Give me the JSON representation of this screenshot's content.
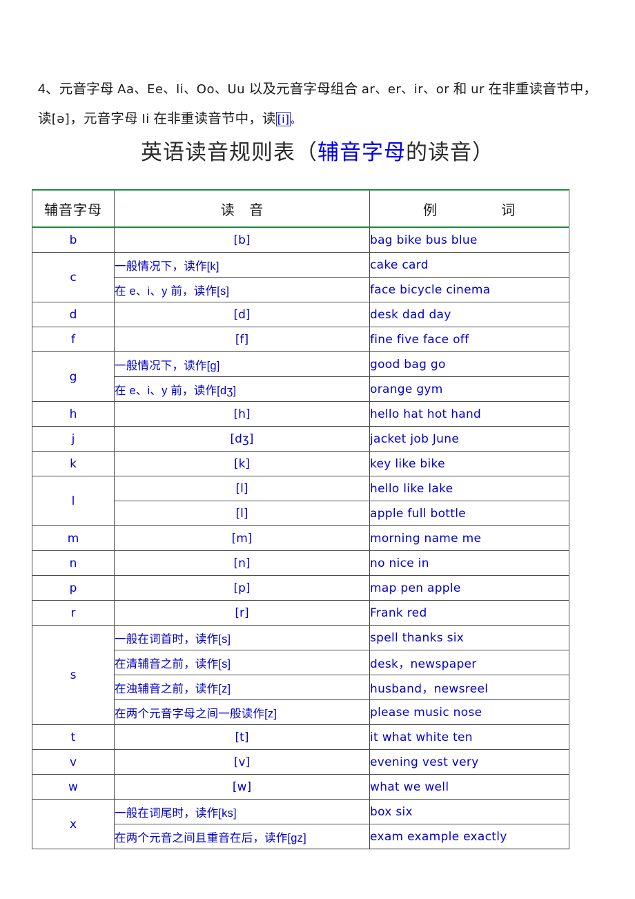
{
  "intro": {
    "line1_a": "4、元音字母 ",
    "line1_latin1": "Aa、Ee、Ii、Oo、Uu",
    "line1_b": " 以及元音字母组合 ",
    "line1_latin2": "ar、er、ir、or",
    "line1_c": " 和 ",
    "line1_latin3": "ur",
    "line1_d": " 在非重读音节中，读",
    "line1_ipa1": "[ə]",
    "line1_e": "，元音字母 ",
    "line1_latin4": "Ii",
    "line1_f": " 在非重读音节中，读",
    "line1_ipa2": "[i]",
    "line1_g": "。"
  },
  "title": {
    "prefix": "英语读音规则表（",
    "highlight": "辅音字母",
    "suffix": "的读音）"
  },
  "table": {
    "headers": {
      "letter": "辅音字母",
      "pronunciation": "读 音",
      "examples_a": "例",
      "examples_b": "词"
    },
    "rows": [
      {
        "letter": "b",
        "subrows": [
          {
            "rule": "",
            "ipa": "[b]",
            "words": "bag  bike  bus  blue"
          }
        ]
      },
      {
        "letter": "c",
        "subrows": [
          {
            "rule": "一般情况下，读作[k]",
            "ipa": "",
            "words": "cake   card"
          },
          {
            "rule": "在 e、i、y 前，读作[s]",
            "ipa": "",
            "words": "face  bicycle  cinema"
          }
        ]
      },
      {
        "letter": "d",
        "subrows": [
          {
            "rule": "",
            "ipa": "[d]",
            "words": "desk  dad  day"
          }
        ]
      },
      {
        "letter": "f",
        "subrows": [
          {
            "rule": "",
            "ipa": "[f]",
            "words": "fine  five  face  off"
          }
        ]
      },
      {
        "letter": "g",
        "subrows": [
          {
            "rule": "一般情况下，读作[g]",
            "ipa": "",
            "words": "good  bag  go"
          },
          {
            "rule": "在 e、i、y 前，读作[dʒ]",
            "ipa": "",
            "words": "orange  gym"
          }
        ]
      },
      {
        "letter": "h",
        "subrows": [
          {
            "rule": "",
            "ipa": "[h]",
            "words": "hello  hat  hot  hand"
          }
        ]
      },
      {
        "letter": "j",
        "subrows": [
          {
            "rule": "",
            "ipa": "[dʒ]",
            "words": "jacket  job  June"
          }
        ]
      },
      {
        "letter": "k",
        "subrows": [
          {
            "rule": "",
            "ipa": "[k]",
            "words": "key  like  bike"
          }
        ]
      },
      {
        "letter": "l",
        "subrows": [
          {
            "rule": "",
            "ipa": "[l]",
            "words": "hello  like  lake"
          },
          {
            "rule": "",
            "ipa": "[l]",
            "words": "apple  full  bottle"
          }
        ]
      },
      {
        "letter": "m",
        "subrows": [
          {
            "rule": "",
            "ipa": "[m]",
            "words": "morning  name  me"
          }
        ]
      },
      {
        "letter": "n",
        "subrows": [
          {
            "rule": "",
            "ipa": "[n]",
            "words": "no  nice  in"
          }
        ]
      },
      {
        "letter": "p",
        "subrows": [
          {
            "rule": "",
            "ipa": "[p]",
            "words": "map  pen  apple"
          }
        ]
      },
      {
        "letter": "r",
        "subrows": [
          {
            "rule": "",
            "ipa": "[r]",
            "words": "Frank  red"
          }
        ]
      },
      {
        "letter": "s",
        "subrows": [
          {
            "rule": "一般在词首时，读作[s]",
            "ipa": "",
            "words": "spell  thanks  six"
          },
          {
            "rule": "在清辅音之前，读作[s]",
            "ipa": "",
            "words": "desk，newspaper"
          },
          {
            "rule": "在浊辅音之前，读作[z]",
            "ipa": "",
            "words": "husband，newsreel"
          },
          {
            "rule": "在两个元音字母之间一般读作[z]",
            "ipa": "",
            "words": "please  music  nose"
          }
        ]
      },
      {
        "letter": "t",
        "subrows": [
          {
            "rule": "",
            "ipa": "[t]",
            "words": "it  what  white  ten"
          }
        ]
      },
      {
        "letter": "v",
        "subrows": [
          {
            "rule": "",
            "ipa": "[v]",
            "words": "evening  vest  very"
          }
        ]
      },
      {
        "letter": "w",
        "subrows": [
          {
            "rule": "",
            "ipa": "[w]",
            "words": "what  we  well"
          }
        ]
      },
      {
        "letter": "x",
        "subrows": [
          {
            "rule": "一般在词尾时，读作[ks]",
            "ipa": "",
            "words": "box  six"
          },
          {
            "rule": "在两个元音之间且重音在后，读作[gz]",
            "ipa": "",
            "words": "exam  example  exactly"
          }
        ]
      }
    ]
  },
  "colors": {
    "text_blue": "#0000CC",
    "title_blue": "#0000EE",
    "border_green": "#1f8a3b",
    "border_dark": "#4d4d4d"
  }
}
